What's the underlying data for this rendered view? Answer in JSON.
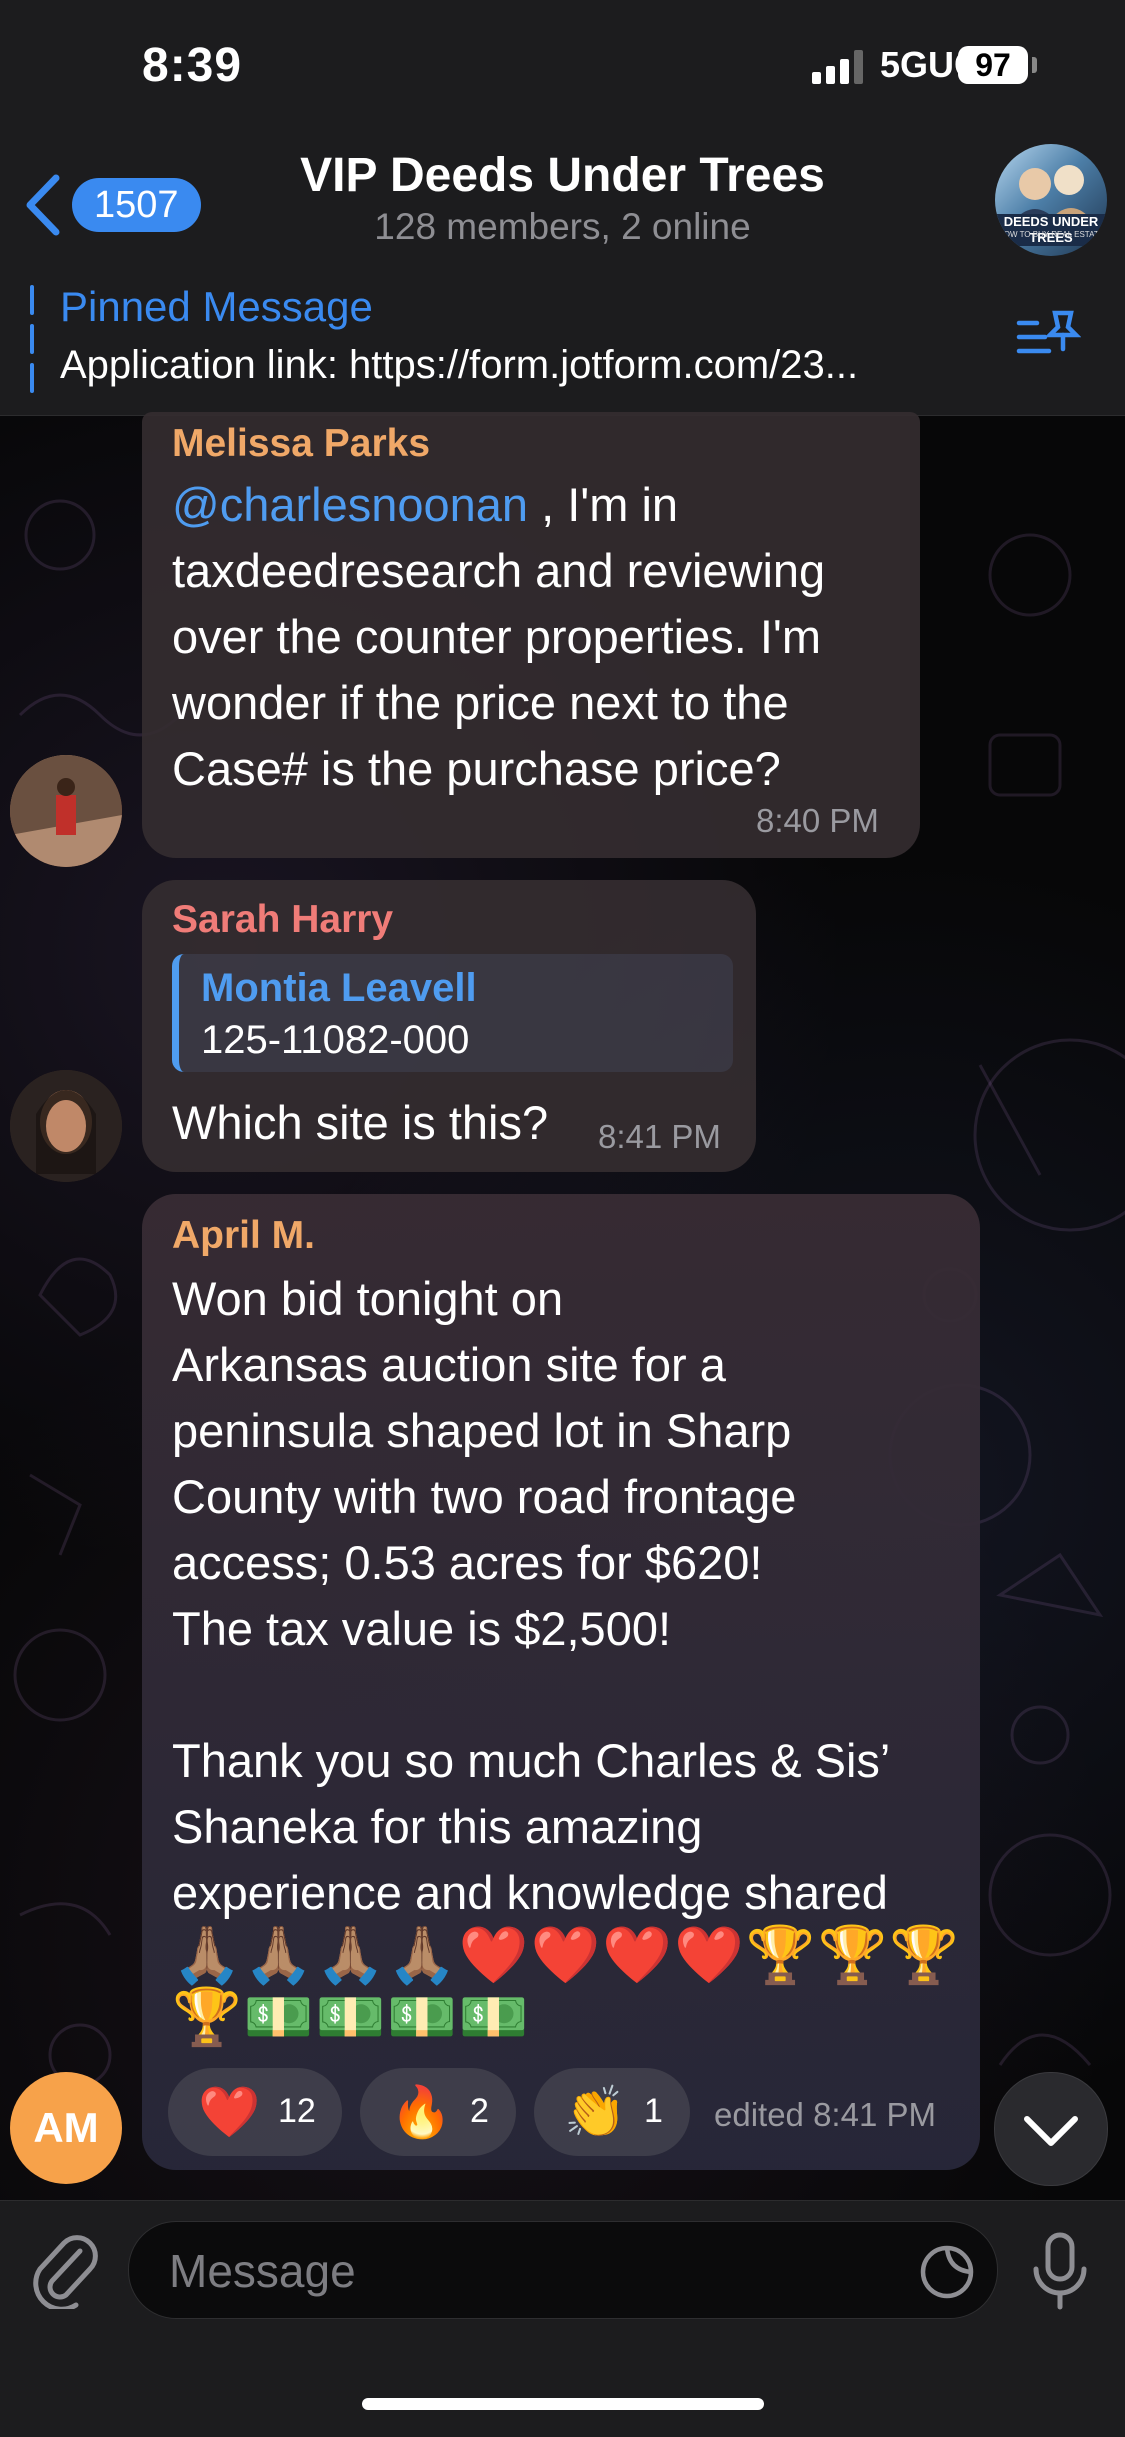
{
  "status_bar": {
    "time": "8:39",
    "network": "5GUC",
    "battery": "97"
  },
  "header": {
    "back_count": "1507",
    "title": "VIP Deeds Under Trees",
    "subtitle": "128 members, 2 online",
    "avatar_text": "DEEDS UNDER TREES",
    "avatar_subtext": "HOW TO BUY REAL ESTATE"
  },
  "pinned": {
    "title": "Pinned Message",
    "text": "Application link: https://form.jotform.com/23..."
  },
  "messages": [
    {
      "sender": "Melissa Parks",
      "sender_color": "#f0a868",
      "mention": "@charlesnoonan",
      "text": " , I'm in\ntaxdeedresearch and reviewing\nover the counter properties. I'm\nwonder if the price next to the\nCase# is the purchase price?",
      "time": "8:40 PM"
    },
    {
      "sender": "Sarah Harry",
      "sender_color": "#f07c78",
      "reply_name": "Montia Leavell",
      "reply_text": "125-11082-000",
      "text": "Which site is this?",
      "time": "8:41 PM"
    },
    {
      "sender": "April M.",
      "sender_color": "#f0a868",
      "text": "Won bid tonight on\nArkansas auction site for a\npeninsula shaped lot in Sharp\nCounty with two road frontage\naccess; 0.53 acres for $620!\nThe tax value is $2,500!\n\nThank you so much Charles & Sis’\nShaneka for this amazing\nexperience and knowledge shared",
      "emoji_line1": "🙏🏽🙏🏽🙏🏽🙏🏽❤️❤️❤️❤️🏆🏆🏆",
      "emoji_line2": "🏆💵💵💵💵",
      "reactions": [
        {
          "emoji": "❤️",
          "count": "12"
        },
        {
          "emoji": "🔥",
          "count": "2"
        },
        {
          "emoji": "👏",
          "count": "1"
        }
      ],
      "time": "edited 8:41 PM",
      "avatar_initials": "AM"
    }
  ],
  "input": {
    "placeholder": "Message"
  },
  "icons": [
    "back-chevron-icon",
    "pin-list-icon",
    "attach-icon",
    "sticker-icon",
    "mic-icon",
    "chevron-down-icon"
  ]
}
